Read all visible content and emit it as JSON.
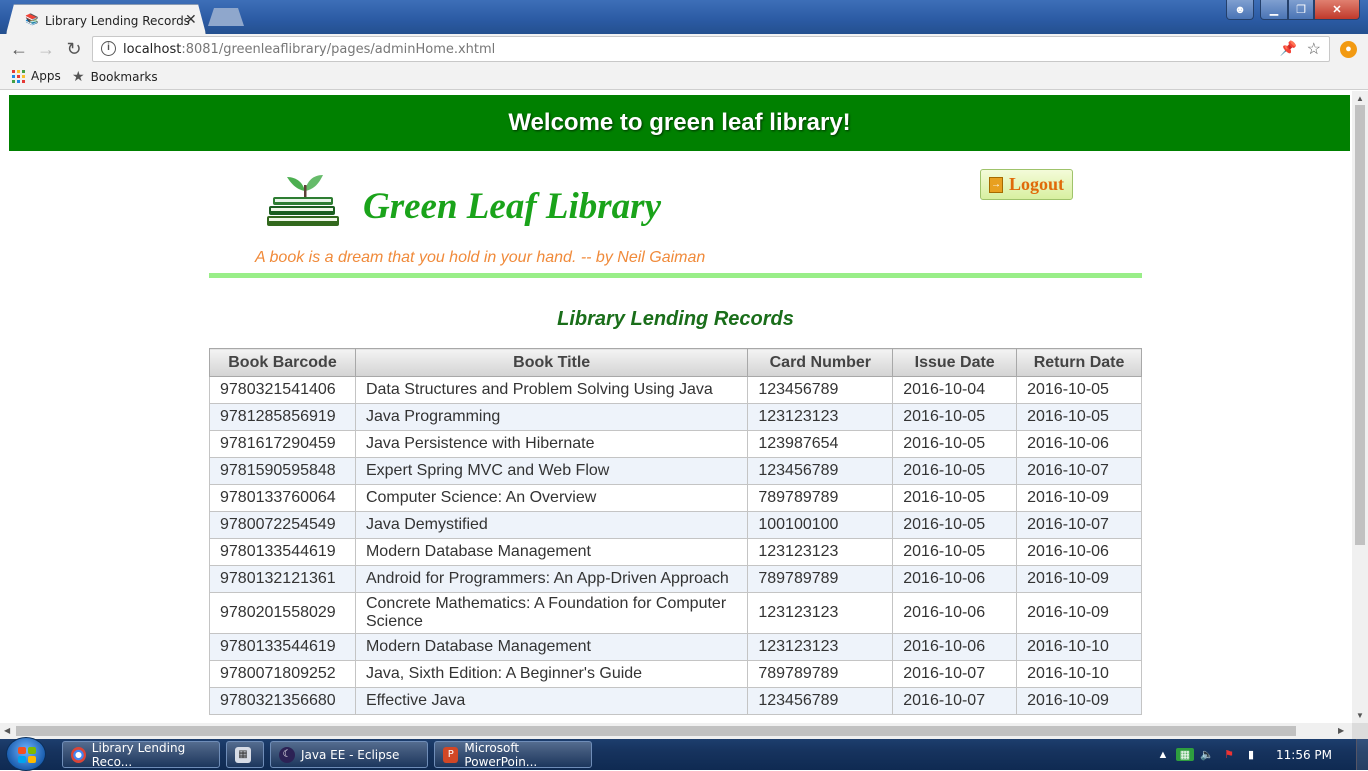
{
  "browser": {
    "tab_title": "Library Lending Records",
    "tab_close": "✕",
    "url_host": "localhost",
    "url_rest": ":8081/greenleaflibrary/pages/adminHome.xhtml",
    "bookmarks": [
      {
        "label": "Apps"
      },
      {
        "label": "Bookmarks"
      }
    ],
    "window_controls": {
      "minimize": "▁",
      "maximize": "❐",
      "close": "✕",
      "user": "👤"
    }
  },
  "page": {
    "welcome_banner": "Welcome to green leaf library!",
    "library_name": "Green Leaf Library",
    "logout_label": "Logout",
    "quote": "A book is a dream that you hold in your hand. -- by Neil Gaiman",
    "section_title": "Library Lending Records",
    "table": {
      "columns": [
        "Book Barcode",
        "Book Title",
        "Card Number",
        "Issue Date",
        "Return Date"
      ],
      "rows": [
        [
          "9780321541406",
          "Data Structures and Problem Solving Using Java",
          "123456789",
          "2016-10-04",
          "2016-10-05"
        ],
        [
          "9781285856919",
          "Java Programming",
          "123123123",
          "2016-10-05",
          "2016-10-05"
        ],
        [
          "9781617290459",
          "Java Persistence with Hibernate",
          "123987654",
          "2016-10-05",
          "2016-10-06"
        ],
        [
          "9781590595848",
          "Expert Spring MVC and Web Flow",
          "123456789",
          "2016-10-05",
          "2016-10-07"
        ],
        [
          "9780133760064",
          "Computer Science: An Overview",
          "789789789",
          "2016-10-05",
          "2016-10-09"
        ],
        [
          "9780072254549",
          "Java Demystified",
          "100100100",
          "2016-10-05",
          "2016-10-07"
        ],
        [
          "9780133544619",
          "Modern Database Management",
          "123123123",
          "2016-10-05",
          "2016-10-06"
        ],
        [
          "9780132121361",
          "Android for Programmers: An App-Driven Approach",
          "789789789",
          "2016-10-06",
          "2016-10-09"
        ],
        [
          "9780201558029",
          "Concrete Mathematics: A Foundation for Computer Science",
          "123123123",
          "2016-10-06",
          "2016-10-09"
        ],
        [
          "9780133544619",
          "Modern Database Management",
          "123123123",
          "2016-10-06",
          "2016-10-10"
        ],
        [
          "9780071809252",
          "Java, Sixth Edition: A Beginner's Guide",
          "789789789",
          "2016-10-07",
          "2016-10-10"
        ],
        [
          "9780321356680",
          "Effective Java",
          "123456789",
          "2016-10-07",
          "2016-10-09"
        ]
      ]
    }
  },
  "taskbar": {
    "items": [
      {
        "label": "Library Lending Reco...",
        "icon": "chrome-icon"
      },
      {
        "label": "",
        "icon": "calculator-icon"
      },
      {
        "label": "Java EE - Eclipse",
        "icon": "eclipse-icon"
      },
      {
        "label": "Microsoft PowerPoin...",
        "icon": "powerpoint-icon"
      }
    ],
    "clock": "11:56 PM"
  },
  "colors": {
    "banner_green": "#008000",
    "title_green": "#1aa31a",
    "quote_orange": "#f08a3a",
    "rule_green": "#99ee88"
  }
}
